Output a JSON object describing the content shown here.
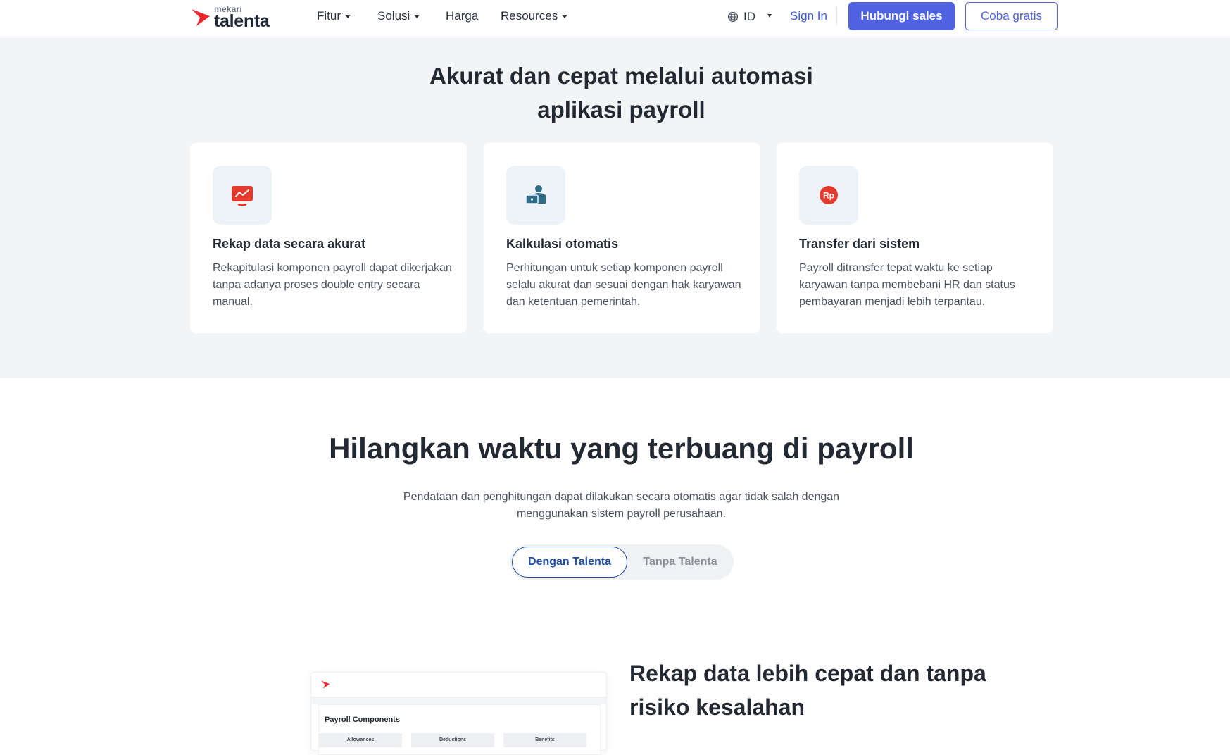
{
  "nav": {
    "logo_small": "mekari",
    "logo_big": "talenta",
    "items": [
      {
        "label": "Fitur",
        "dropdown": true
      },
      {
        "label": "Solusi",
        "dropdown": true
      },
      {
        "label": "Harga",
        "dropdown": false
      },
      {
        "label": "Resources",
        "dropdown": true
      }
    ],
    "language": "ID",
    "signin": "Sign In",
    "sales_button": "Hubungi sales",
    "trial_button": "Coba gratis",
    "accent_color": "#4f63e0"
  },
  "section1": {
    "title_line1": "Akurat dan cepat melalui automasi",
    "title_line2": "aplikasi payroll",
    "cards": [
      {
        "icon": "monitor-chart-icon",
        "title": "Rekap data secara akurat",
        "desc": "Rekapitulasi komponen payroll dapat dikerjakan tanpa adanya proses double entry secara manual."
      },
      {
        "icon": "user-laptop-icon",
        "title": "Kalkulasi otomatis",
        "desc": "Perhitungan untuk setiap komponen payroll selalu akurat dan sesuai dengan hak karyawan dan ketentuan pemerintah."
      },
      {
        "icon": "rupiah-coin-icon",
        "title": "Transfer dari sistem",
        "desc": "Payroll ditransfer tepat waktu ke setiap karyawan tanpa membebani HR dan status pembayaran menjadi lebih terpantau."
      }
    ]
  },
  "section2": {
    "title": "Hilangkan waktu yang terbuang di payroll",
    "subtitle": "Pendataan dan penghitungan dapat dilakukan secara otomatis agar tidak salah dengan menggunakan sistem payroll perusahaan.",
    "toggle_active": "Dengan Talenta",
    "toggle_inactive": "Tanpa Talenta"
  },
  "section3": {
    "title": "Rekap data lebih cepat dan tanpa risiko kesalahan",
    "preview": {
      "title": "Payroll Components",
      "tabs": [
        "Allowances",
        "Deductions",
        "Benefits"
      ]
    }
  }
}
